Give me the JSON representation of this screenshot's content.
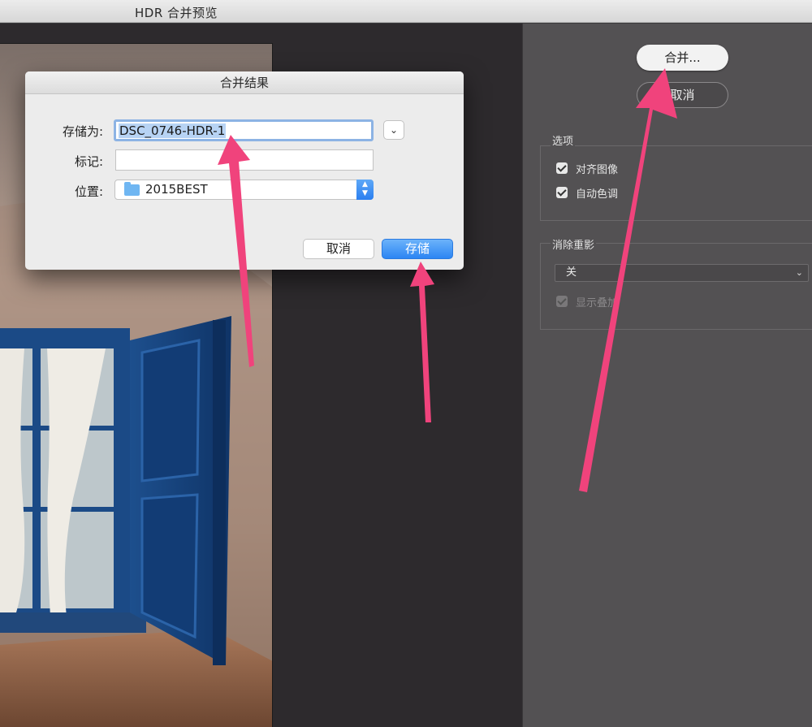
{
  "window": {
    "title": "HDR 合并预览"
  },
  "panel": {
    "merge_button": "合并...",
    "cancel_button": "取消",
    "options": {
      "title": "选项",
      "align_images": {
        "label": "对齐图像",
        "checked": true
      },
      "auto_tone": {
        "label": "自动色调",
        "checked": true
      }
    },
    "ghost_removal": {
      "title": "消除重影",
      "select_value": "关",
      "show_overlay": {
        "label": "显示叠加",
        "checked": true,
        "disabled": true
      }
    }
  },
  "dialog": {
    "title": "合并结果",
    "save_as_label": "存储为:",
    "save_as_value": "DSC_0746-HDR-1",
    "tags_label": "标记:",
    "tags_value": "",
    "location_label": "位置:",
    "location_value": "2015BEST",
    "cancel_button": "取消",
    "save_button": "存储"
  },
  "annotations": {
    "arrow_color": "#f0437c"
  },
  "icons": {
    "expand": "chevron-down-icon",
    "folder": "folder-icon",
    "stepper": "up-down-stepper-icon",
    "select_chevron": "chevron-down-icon",
    "checkbox": "checkmark-icon"
  }
}
